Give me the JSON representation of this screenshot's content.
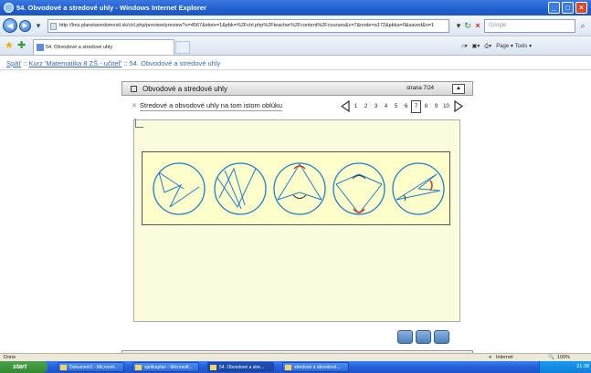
{
  "window": {
    "title": "54. Obvodové a stredové uhly - Windows Internet Explorer",
    "url": "http://lms.planetavedomosti.sk/ctrl.php/preview/preview?u=4567&store=1&pbk=%2Fctrl.php%2Fteacher%2Fcontent%2Fcourses&c=7&node=a172&pbka=0&saved&n=1",
    "search_placeholder": "Google",
    "tab_label": "54. Obvodové a stredové uhly",
    "tools_label": "Page ▾  Tools ▾"
  },
  "breadcrumb": {
    "back": "Späť",
    "sep1": " :: ",
    "course": "Kurz 'Matematika 8 ZŠ - učiteľ'",
    "sep2": " :: ",
    "lesson": "54. Obvodové a stredové uhly"
  },
  "lesson": {
    "title": "Obvodové a stredové uhly",
    "page_label": "strana 7/24",
    "subtitle": "Stredové a obvodové uhly na tom istom oblúku",
    "pages": [
      "1",
      "2",
      "3",
      "4",
      "5",
      "6",
      "7",
      "8",
      "9",
      "10"
    ],
    "current_page": "7"
  },
  "statusbar": {
    "left": "Done",
    "zone": "Internet",
    "zoom": "100%"
  },
  "taskbar": {
    "start": "start",
    "tasks": [
      "Dokument1 - Microsof...",
      "sprilkaplan - Microsoft...",
      "54. Obvodové a stre...",
      "stredové a obvodové..."
    ],
    "clock": "21:38"
  },
  "colors": {
    "circle": "#1e7ec8",
    "arc": "#e03020",
    "figure_bg": "#ffffcc"
  }
}
